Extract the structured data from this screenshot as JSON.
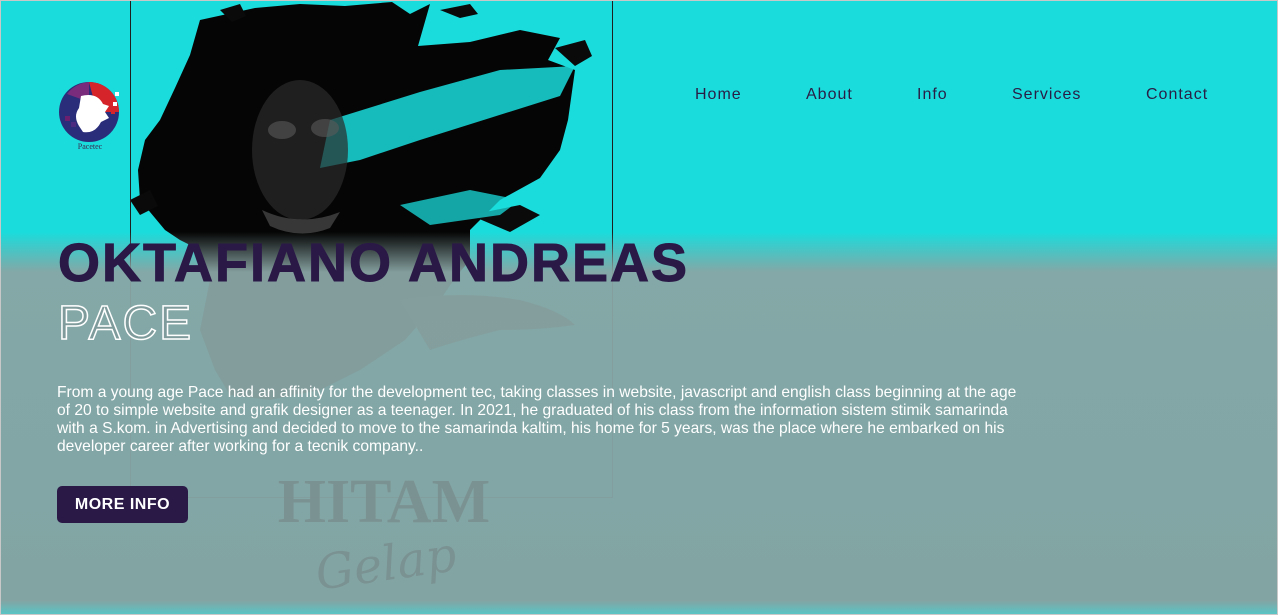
{
  "colors": {
    "background": "#1adcdc",
    "overlay": "#89a5a4",
    "accent_dark": "#2a1847",
    "nav_text": "#2a1d45",
    "bio_text": "#ffffff"
  },
  "logo": {
    "icon": "pacetec-logo-icon",
    "caption": "Pacetec"
  },
  "nav": {
    "items": [
      {
        "label": "Home"
      },
      {
        "label": "About"
      },
      {
        "label": "Info"
      },
      {
        "label": "Services"
      },
      {
        "label": "Contact"
      }
    ]
  },
  "hero": {
    "name": "OKTAFIANO ANDREAS",
    "subtitle": "PACE",
    "bio": "From a young age Pace had an affinity for the development tec, taking classes in website, javascript and english class beginning at the age of 20 to simple website and grafik designer as a teenager. In 2021, he graduated of his class from the information sistem stimik samarinda with a S.kom. in Advertising and decided to move to the samarinda kaltim, his home for 5 years, was the place where he embarked on his developer career after working for a tecnik company..",
    "button_label": "MORE INFO"
  },
  "artwork": {
    "portrait_icon": "portrait-brush-icon",
    "watermark_line1": "HITAM",
    "watermark_line2": "Gelap"
  }
}
